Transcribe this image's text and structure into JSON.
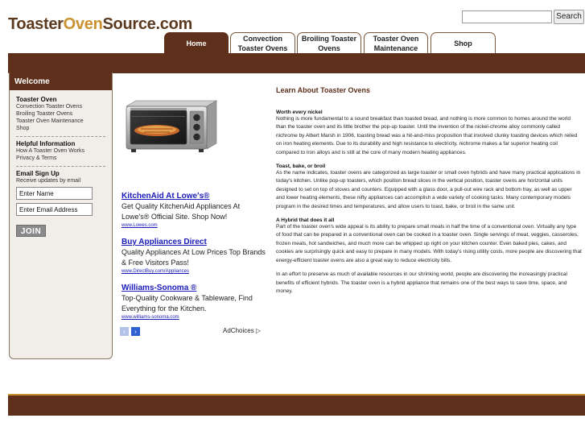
{
  "logo": {
    "part1": "Toaster",
    "part2": "Oven",
    "part3": "Source.com"
  },
  "search": {
    "button_label": "Search",
    "value": ""
  },
  "tabs": [
    {
      "label": "Home",
      "active": true
    },
    {
      "label": "Convection Toaster Ovens",
      "active": false
    },
    {
      "label": "Broiling Toaster Ovens",
      "active": false
    },
    {
      "label": "Toaster Oven Maintenance",
      "active": false
    },
    {
      "label": "Shop",
      "active": false
    }
  ],
  "sidebar": {
    "header": "Welcome",
    "section1": {
      "heading": "Toaster Oven",
      "links": [
        "Convection Toaster Ovens",
        "Broiling Toaster Ovens",
        "Toaster Oven Maintenance",
        "Shop"
      ]
    },
    "section2": {
      "heading": "Helpful Information",
      "links": [
        "How A Toaster Oven Works",
        "Privacy & Terms"
      ]
    },
    "signup": {
      "heading": "Email Sign Up",
      "subtext": "Receive updates by email",
      "name_value": "Enter Name",
      "email_value": "Enter Email Address",
      "join_label": "JOIN"
    }
  },
  "ads": [
    {
      "title": "KitchenAid At Lowe's®",
      "desc": "Get Quality KitchenAid Appliances At Lowe's® Official Site. Shop Now!",
      "url": "www.Lowes.com"
    },
    {
      "title": "Buy Appliances Direct",
      "desc": "Quality Appliances At Low Prices Top Brands & Free Visitors Pass!",
      "url": "www.DirectBuy.com/Appliances"
    },
    {
      "title": "Williams-Sonoma ®",
      "desc": "Top-Quality Cookware & Tableware, Find Everything for the Kitchen.",
      "url": "www.williams-sonoma.com"
    }
  ],
  "adchoices": "AdChoices",
  "main": {
    "title": "Learn About Toaster Ovens",
    "sections": [
      {
        "heading": "Worth every nickel",
        "text": "Nothing is more fundamental to a sound breakfast than toasted bread, and nothing is more common to homes around the world than the toaster oven and its little brother the pop-up toaster. Until the invention of the nickel-chrome alloy commonly called nichrome by Albert Marsh in 1906, toasting bread was a hit-and-miss proposition that involved clunky toasting devices which relied on iron heating elements. Due to its durability and high resistance to electricity, nichrome makes a far superior heating coil compared to iron alloys and is still at the core of many modern heating appliances."
      },
      {
        "heading": "Toast, bake, or broil",
        "text": "As the name indicates, toaster ovens are categorized as large toaster or small oven hybrids and have many practical applications in today's kitchen. Unlike pop-up toasters, which position bread slices in the vertical position, toaster ovens are horizontal units designed to set on top of stoves and counters. Equipped with a glass door, a pull-out wire rack and bottom tray, as well as upper and lower heating elements, these nifty appliances can accomplish a wide variety of cooking tasks. Many contemporary models program in the desired times and temperatures, and allow users to toast, bake, or broil in the same unit."
      },
      {
        "heading": "A Hybrid that does it all",
        "text": "Part of the toaster oven's wide appeal is its ability to prepare small meals in half the time of a conventional oven. Virtually any type of food that can be prepared in a conventional oven can be cooked in a toaster oven. Single servings of meat, veggies, casseroles, frozen meals, hot sandwiches, and much more can be whipped up right on your kitchen counter. Even baked pies, cakes, and cookies are surprisingly quick and easy to prepare in many models. With today's rising utility costs, more people are discovering that energy-efficient toaster ovens are also a great way to reduce electricity bills."
      }
    ],
    "closing": "In an effort to preserve as much of available resources in our shrinking world, people are discovering the increasingly practical benefits of efficient hybrids. The toaster oven is a hybrid appliance that remains one of the best ways to save time, space, and money."
  },
  "colors": {
    "brand_brown": "#5e2f1b",
    "brand_gold": "#c9912f",
    "link_blue": "#1a1ab8"
  }
}
